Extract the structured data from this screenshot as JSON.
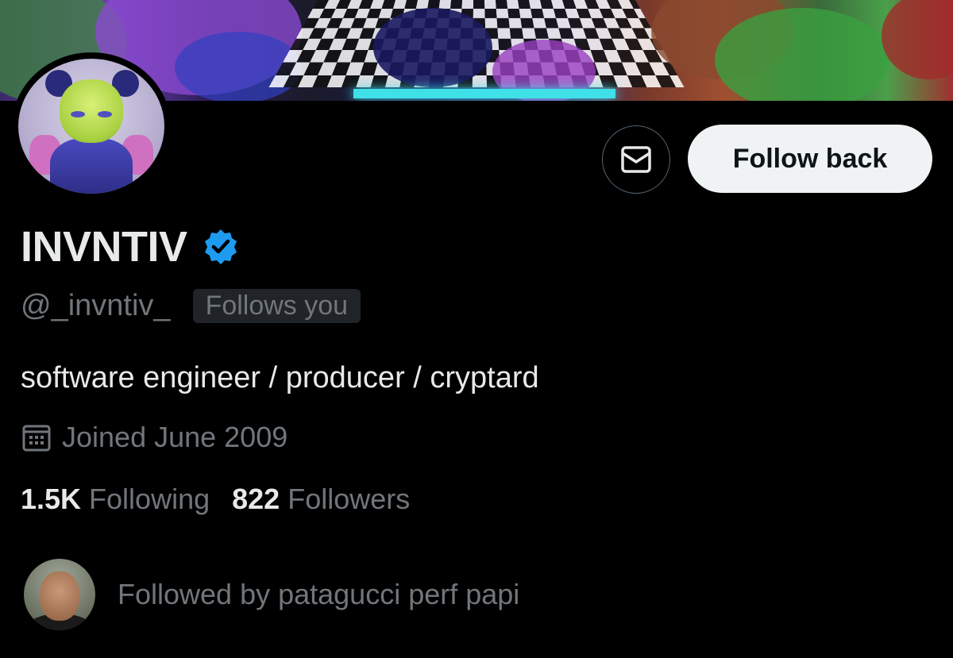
{
  "profile": {
    "name": "INVNTIV",
    "handle": "@_invntiv_",
    "follows_you_badge": "Follows you",
    "bio": "software engineer / producer / cryptard",
    "joined": "Joined June 2009",
    "verified": true
  },
  "actions": {
    "follow_back_label": "Follow back",
    "message_icon": "mail-icon"
  },
  "stats": {
    "following_count": "1.5K",
    "following_label": "Following",
    "followers_count": "822",
    "followers_label": "Followers"
  },
  "followed_by": {
    "text": "Followed by patagucci perf papi"
  },
  "colors": {
    "background": "#000000",
    "primary_text": "#e7e9ea",
    "secondary_text": "#71767b",
    "verified_blue": "#1d9bf0",
    "follow_button_bg": "#eff3f4"
  }
}
